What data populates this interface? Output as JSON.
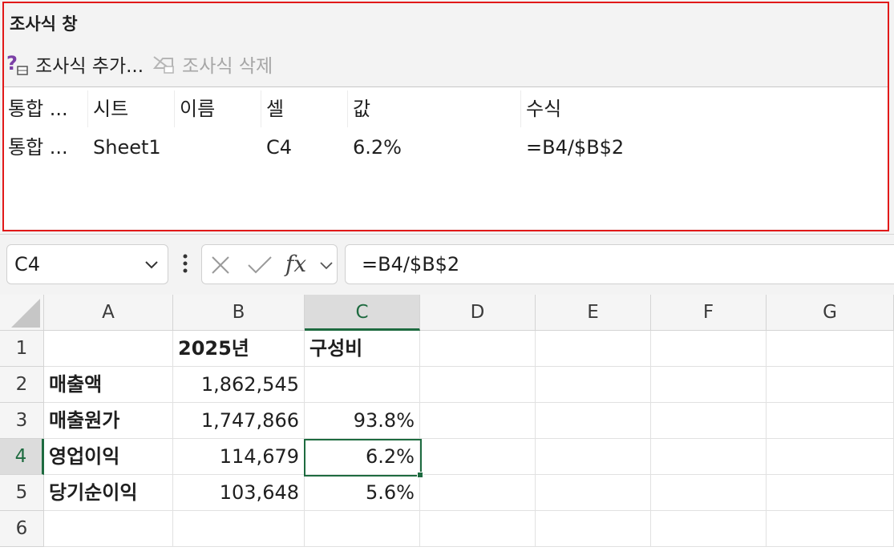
{
  "watch_window": {
    "title": "조사식 창",
    "toolbar": {
      "add_label": "조사식 추가...",
      "delete_label": "조사식 삭제"
    },
    "columns": [
      "통합 ...",
      "시트",
      "이름",
      "셀",
      "값",
      "수식"
    ],
    "rows": [
      {
        "book": "통합 ...",
        "sheet": "Sheet1",
        "name": "",
        "cell": "C4",
        "value": "6.2%",
        "formula": "=B4/$B$2"
      }
    ]
  },
  "formula_bar": {
    "name_box": "C4",
    "fx": "fx",
    "formula": "=B4/$B$2"
  },
  "grid": {
    "columns": [
      "A",
      "B",
      "C",
      "D",
      "E",
      "F",
      "G"
    ],
    "rows": [
      "1",
      "2",
      "3",
      "4",
      "5",
      "6"
    ],
    "active_cell": "C4",
    "cells": {
      "B1": "2025년",
      "C1": "구성비",
      "A2": "매출액",
      "B2": "1,862,545",
      "A3": "매출원가",
      "B3": "1,747,866",
      "C3": "93.8%",
      "A4": "영업이익",
      "B4": "114,679",
      "C4": "6.2%",
      "A5": "당기순이익",
      "B5": "103,648",
      "C5": "5.6%"
    }
  },
  "colors": {
    "highlight_border": "#e11919",
    "excel_green": "#1e6b40",
    "watch_add_icon": "#7b3fa6"
  }
}
